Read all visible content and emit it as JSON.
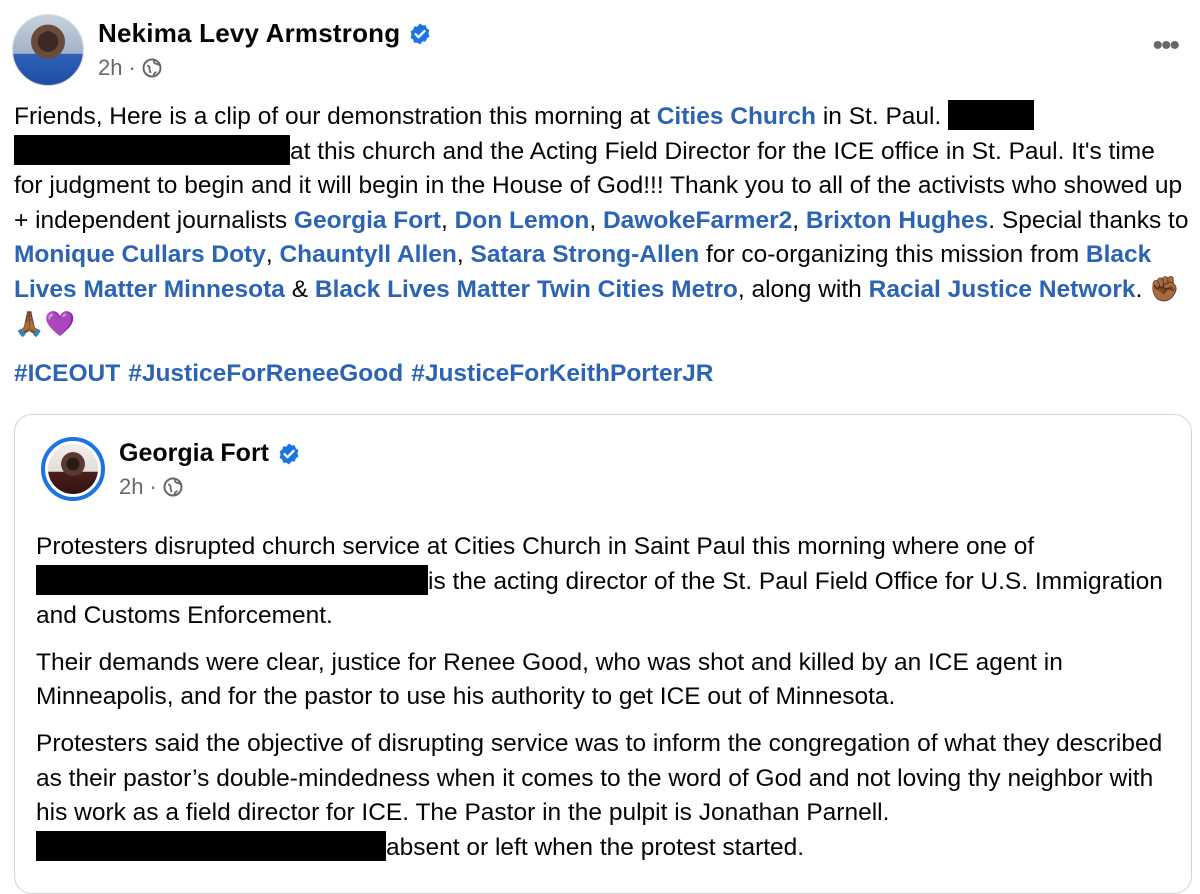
{
  "post": {
    "author": "Nekima Levy Armstrong",
    "time": "2h",
    "separator": "·",
    "more_label": "•••",
    "text_segments": {
      "s1": "Friends, Here is a clip of our demonstration this morning at ",
      "l1": "Cities Church",
      "s2": " in St. Paul. ",
      "s3": "at this church and the Acting Field Director for the ICE office in St. Paul. It's time for judgment to begin and it will begin in the House of God!!! Thank you to all of the activists who showed up + independent journalists ",
      "l2": "Georgia Fort",
      "c1": ", ",
      "l3": "Don Lemon",
      "c2": ", ",
      "l4": "DawokeFarmer2",
      "c3": ", ",
      "l5": "Brixton Hughes",
      "s4": ". Special thanks to ",
      "l6": "Monique Cullars Doty",
      "c4": ", ",
      "l7": "Chauntyll Allen",
      "c5": ", ",
      "l8": "Satara Strong-Allen",
      "s5": " for co-organizing this mission from ",
      "l9": "Black Lives Matter Minnesota",
      "s6": " & ",
      "l10": "Black Lives Matter Twin Cities Metro",
      "s7": ", along with ",
      "l11": "Racial Justice Network",
      "s8": ". ",
      "emoji": "✊🏾🙏🏾💜"
    },
    "hashtags": [
      "#ICEOUT",
      "#JusticeForReneeGood",
      "#JusticeForKeithPorterJR"
    ]
  },
  "shared_post": {
    "author": "Georgia Fort",
    "time": "2h",
    "separator": "·",
    "p1_a": "Protesters disrupted church service at Cities Church in Saint Paul this morning where one of ",
    "p1_b": "is the acting director of the St. Paul Field Office for U.S. Immigration and Customs Enforcement.",
    "p2": "Their demands were clear, justice for Renee Good, who was shot and killed by an ICE agent in Minneapolis, and for the pastor to use his authority to get ICE out of Minnesota.",
    "p3_a": "Protesters said the objective of disrupting service was to inform the congregation of what they described as their pastor’s double-mindedness when it comes to the word of God and not loving thy neighbor with his work as a field director for ICE. The Pastor in the pulpit is Jonathan Parnell. ",
    "p3_b": "absent or left when the protest started."
  },
  "colors": {
    "link": "#2b64b4",
    "verified": "#1b74e4",
    "secondary_text": "#65676b",
    "redaction": "#000000"
  },
  "icons": [
    "verified-badge-icon",
    "globe-icon",
    "more-options-icon"
  ]
}
